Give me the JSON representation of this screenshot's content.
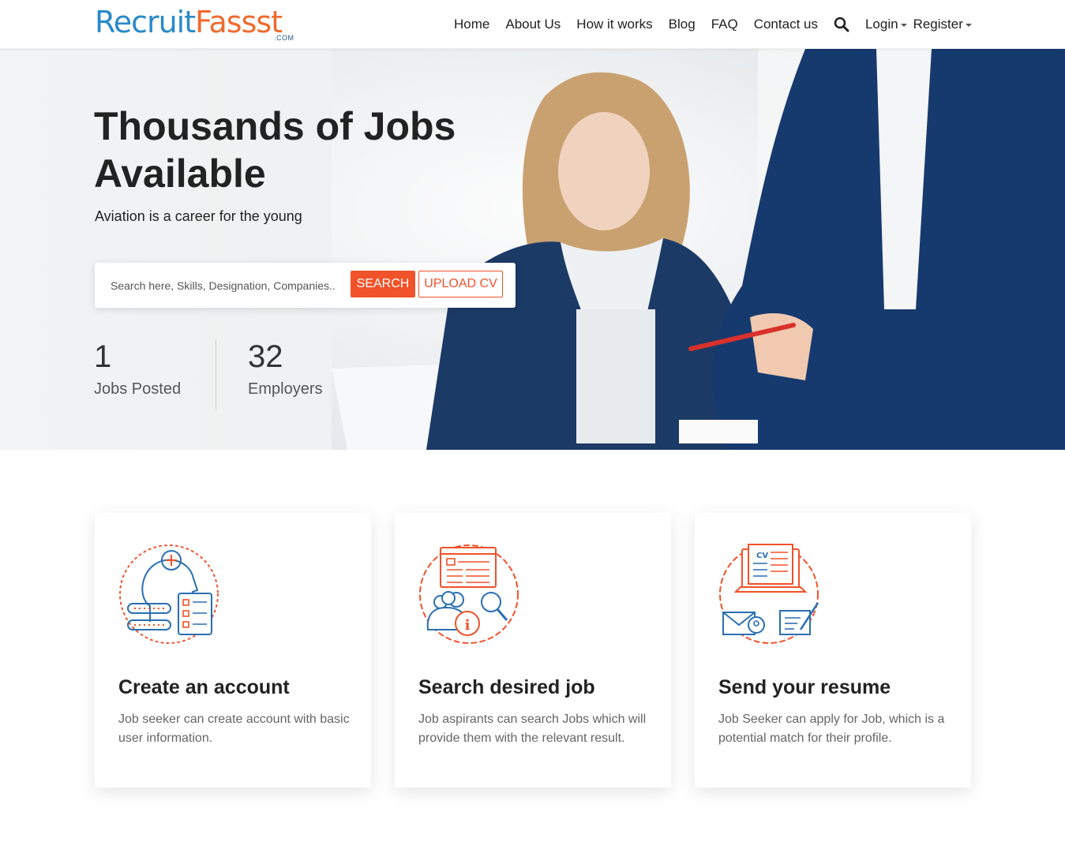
{
  "header": {
    "logo": {
      "part1": "Recruit",
      "part2": "Fassst",
      "suffix": ".COM"
    },
    "nav": {
      "home": "Home",
      "about": "About Us",
      "how": "How it works",
      "blog": "Blog",
      "faq": "FAQ",
      "contact": "Contact us",
      "login": "Login",
      "register": "Register"
    }
  },
  "hero": {
    "title_line1": "Thousands of Jobs",
    "title_line2": "Available",
    "subtitle": "Aviation is a career for the young",
    "search": {
      "placeholder": "Search here, Skills, Designation, Companies..",
      "search_button": "SEARCH",
      "upload_button": "UPLOAD CV"
    },
    "stats": [
      {
        "value": "1",
        "label": "Jobs Posted"
      },
      {
        "value": "32",
        "label": "Employers"
      }
    ]
  },
  "cards": [
    {
      "title": "Create an account",
      "text": "Job seeker can create account with basic user information.",
      "icon": "account-profile-icon"
    },
    {
      "title": "Search desired job",
      "text": "Job aspirants can search Jobs which will provide them with the relevant result.",
      "icon": "job-search-icon"
    },
    {
      "title": "Send your resume",
      "text": "Job Seeker can apply for Job, which is a potential match for their profile.",
      "icon": "send-resume-icon"
    }
  ],
  "colors": {
    "accent": "#f0522a",
    "brand_blue": "#2a8ac9",
    "icon_blue": "#2a6fb3",
    "icon_orange": "#f0522a"
  }
}
